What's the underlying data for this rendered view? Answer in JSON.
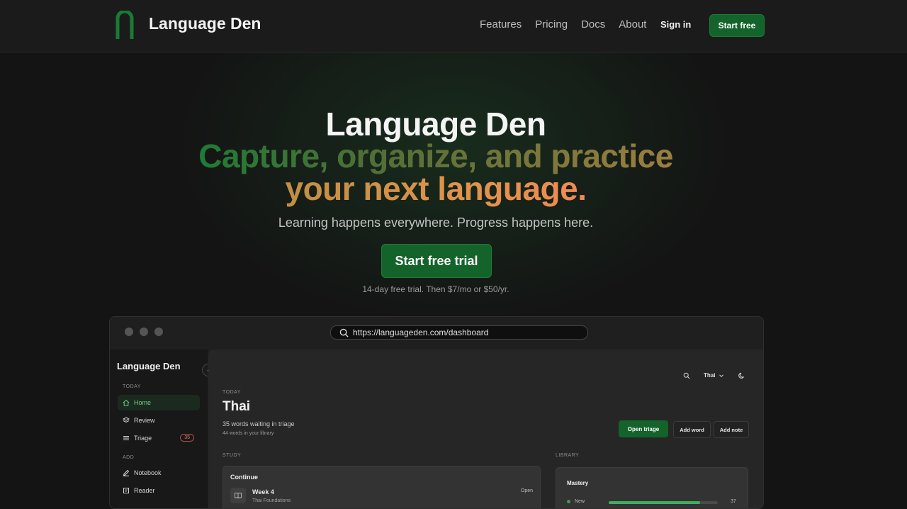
{
  "nav": {
    "brand": "Language Den",
    "links": [
      "Features",
      "Pricing",
      "Docs",
      "About"
    ],
    "sign_in": "Sign in",
    "start_free": "Start free"
  },
  "hero": {
    "title": "Language Den",
    "headline_line1": "Capture, organize, and practice",
    "headline_line2": "your next language.",
    "subtitle": "Learning happens everywhere. Progress happens here.",
    "cta": "Start free trial",
    "note": "14-day free trial. Then $7/mo or $50/yr."
  },
  "browser": {
    "url": "https://languageden.com/dashboard"
  },
  "app": {
    "sidebar": {
      "title": "Language Den",
      "section_today": "TODAY",
      "section_add": "ADD",
      "items": [
        {
          "label": "Home",
          "icon": "home-icon",
          "active": true
        },
        {
          "label": "Review",
          "icon": "review-icon"
        },
        {
          "label": "Triage",
          "icon": "list-icon",
          "badge": "35"
        },
        {
          "label": "Notebook",
          "icon": "notebook-icon"
        },
        {
          "label": "Reader",
          "icon": "reader-icon"
        }
      ]
    },
    "topbar": {
      "language_select": "Thai"
    },
    "main": {
      "today_label": "TODAY",
      "language": "Thai",
      "waiting": "35 words waiting in triage",
      "library_count": "44 words in your library",
      "open_triage": "Open triage",
      "add_word": "Add word",
      "add_note": "Add note",
      "study_label": "STUDY",
      "library_label": "LIBRARY",
      "continue": {
        "title": "Continue",
        "item": "Week 4",
        "item_sub": "Thai Foundations",
        "tag": "Open"
      },
      "mastery": {
        "title": "Mastery",
        "rows": [
          {
            "label": "New",
            "count": "37",
            "fill": 0.84
          }
        ]
      }
    }
  },
  "colors": {
    "accent": "#14632a",
    "background": "#141414",
    "active_text": "#6fcf86"
  }
}
